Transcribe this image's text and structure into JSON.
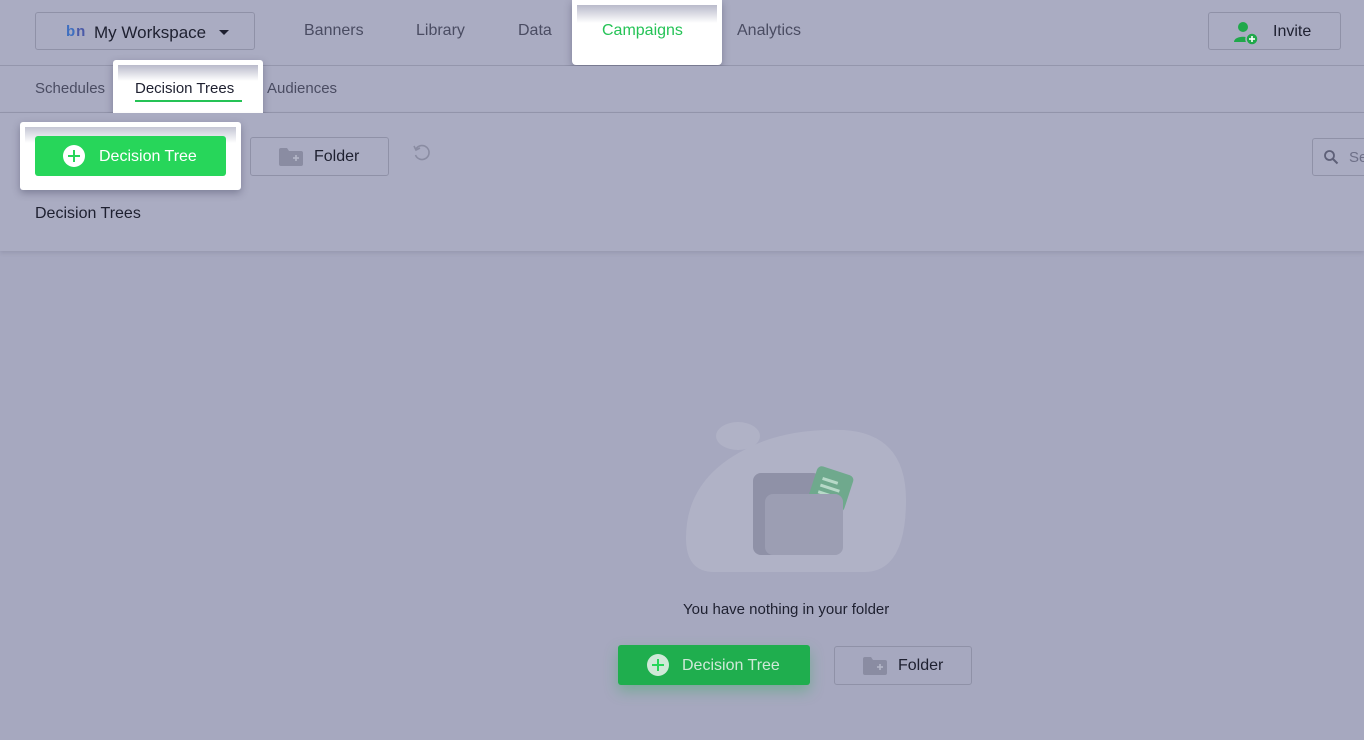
{
  "topnav": {
    "workspace_logo_b": "b",
    "workspace_logo_n": "n",
    "workspace_name": "My Workspace",
    "items": [
      "Banners",
      "Library",
      "Data",
      "Campaigns",
      "Analytics"
    ],
    "invite_label": "Invite"
  },
  "subnav": {
    "items": [
      "Schedules",
      "Decision Trees",
      "Audiences"
    ]
  },
  "toolbar": {
    "add_tree_label": "Decision Tree",
    "add_folder_label": "Folder",
    "search_placeholder": "Se"
  },
  "section_title": "Decision Trees",
  "empty_state": {
    "message": "You have nothing in your folder",
    "add_tree_label": "Decision Tree",
    "add_folder_label": "Folder"
  },
  "colors": {
    "accent_green": "#27d65a",
    "active_text_green": "#25c356"
  }
}
